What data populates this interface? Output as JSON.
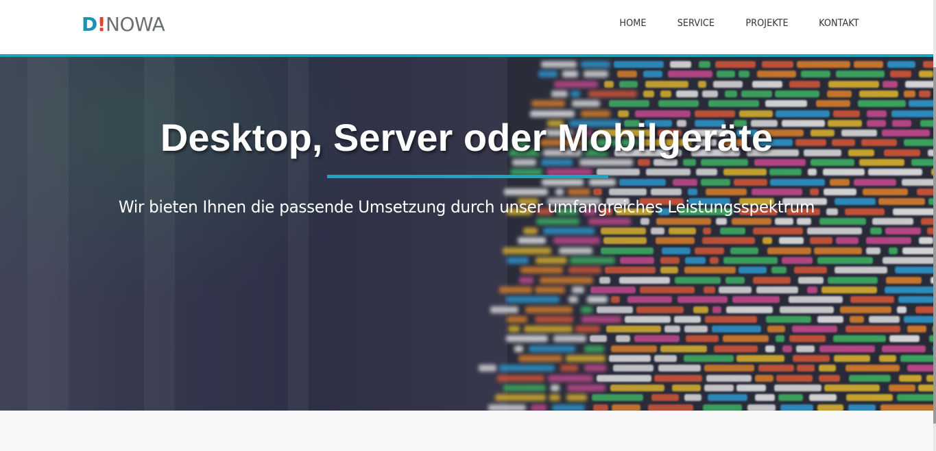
{
  "header": {
    "logo": {
      "d": "D",
      "bang": "!",
      "rest": "NOWA"
    },
    "nav": [
      "HOME",
      "SERVICE",
      "PROJEKTE",
      "KONTAKT"
    ]
  },
  "hero": {
    "title": "Desktop, Server oder Mobilgeräte",
    "subtitle": "Wir bieten Ihnen die passende Umsetzung durch unser umfangreiches Leistungsspektrum",
    "background_image": "blurred source code on monitor",
    "accent_color": "#1aa6c1"
  },
  "colors": {
    "accent": "#1aa6c1",
    "logo_blue": "#1e8fb5",
    "logo_red": "#e4402e",
    "logo_gray": "#6a6f73"
  }
}
